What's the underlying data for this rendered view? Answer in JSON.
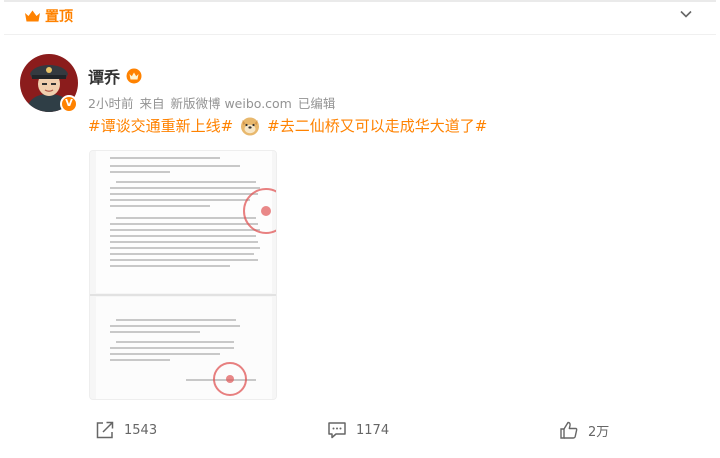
{
  "pin": {
    "label": "置顶",
    "icon": "pin-crown-icon"
  },
  "post": {
    "username": "谭乔",
    "badge": "V",
    "meta": {
      "time": "2小时前",
      "source_prefix": "来自",
      "source": "新版微博 weibo.com",
      "edited": "已编辑"
    },
    "content": {
      "tag1": "#谭谈交通重新上线#",
      "tag2": "#去二仙桥又可以走成华大道了#"
    }
  },
  "actions": {
    "forward_count": "1543",
    "comment_count": "1174",
    "like_count": "2万"
  },
  "colors": {
    "accent": "#ff8200",
    "meta": "#939393"
  }
}
